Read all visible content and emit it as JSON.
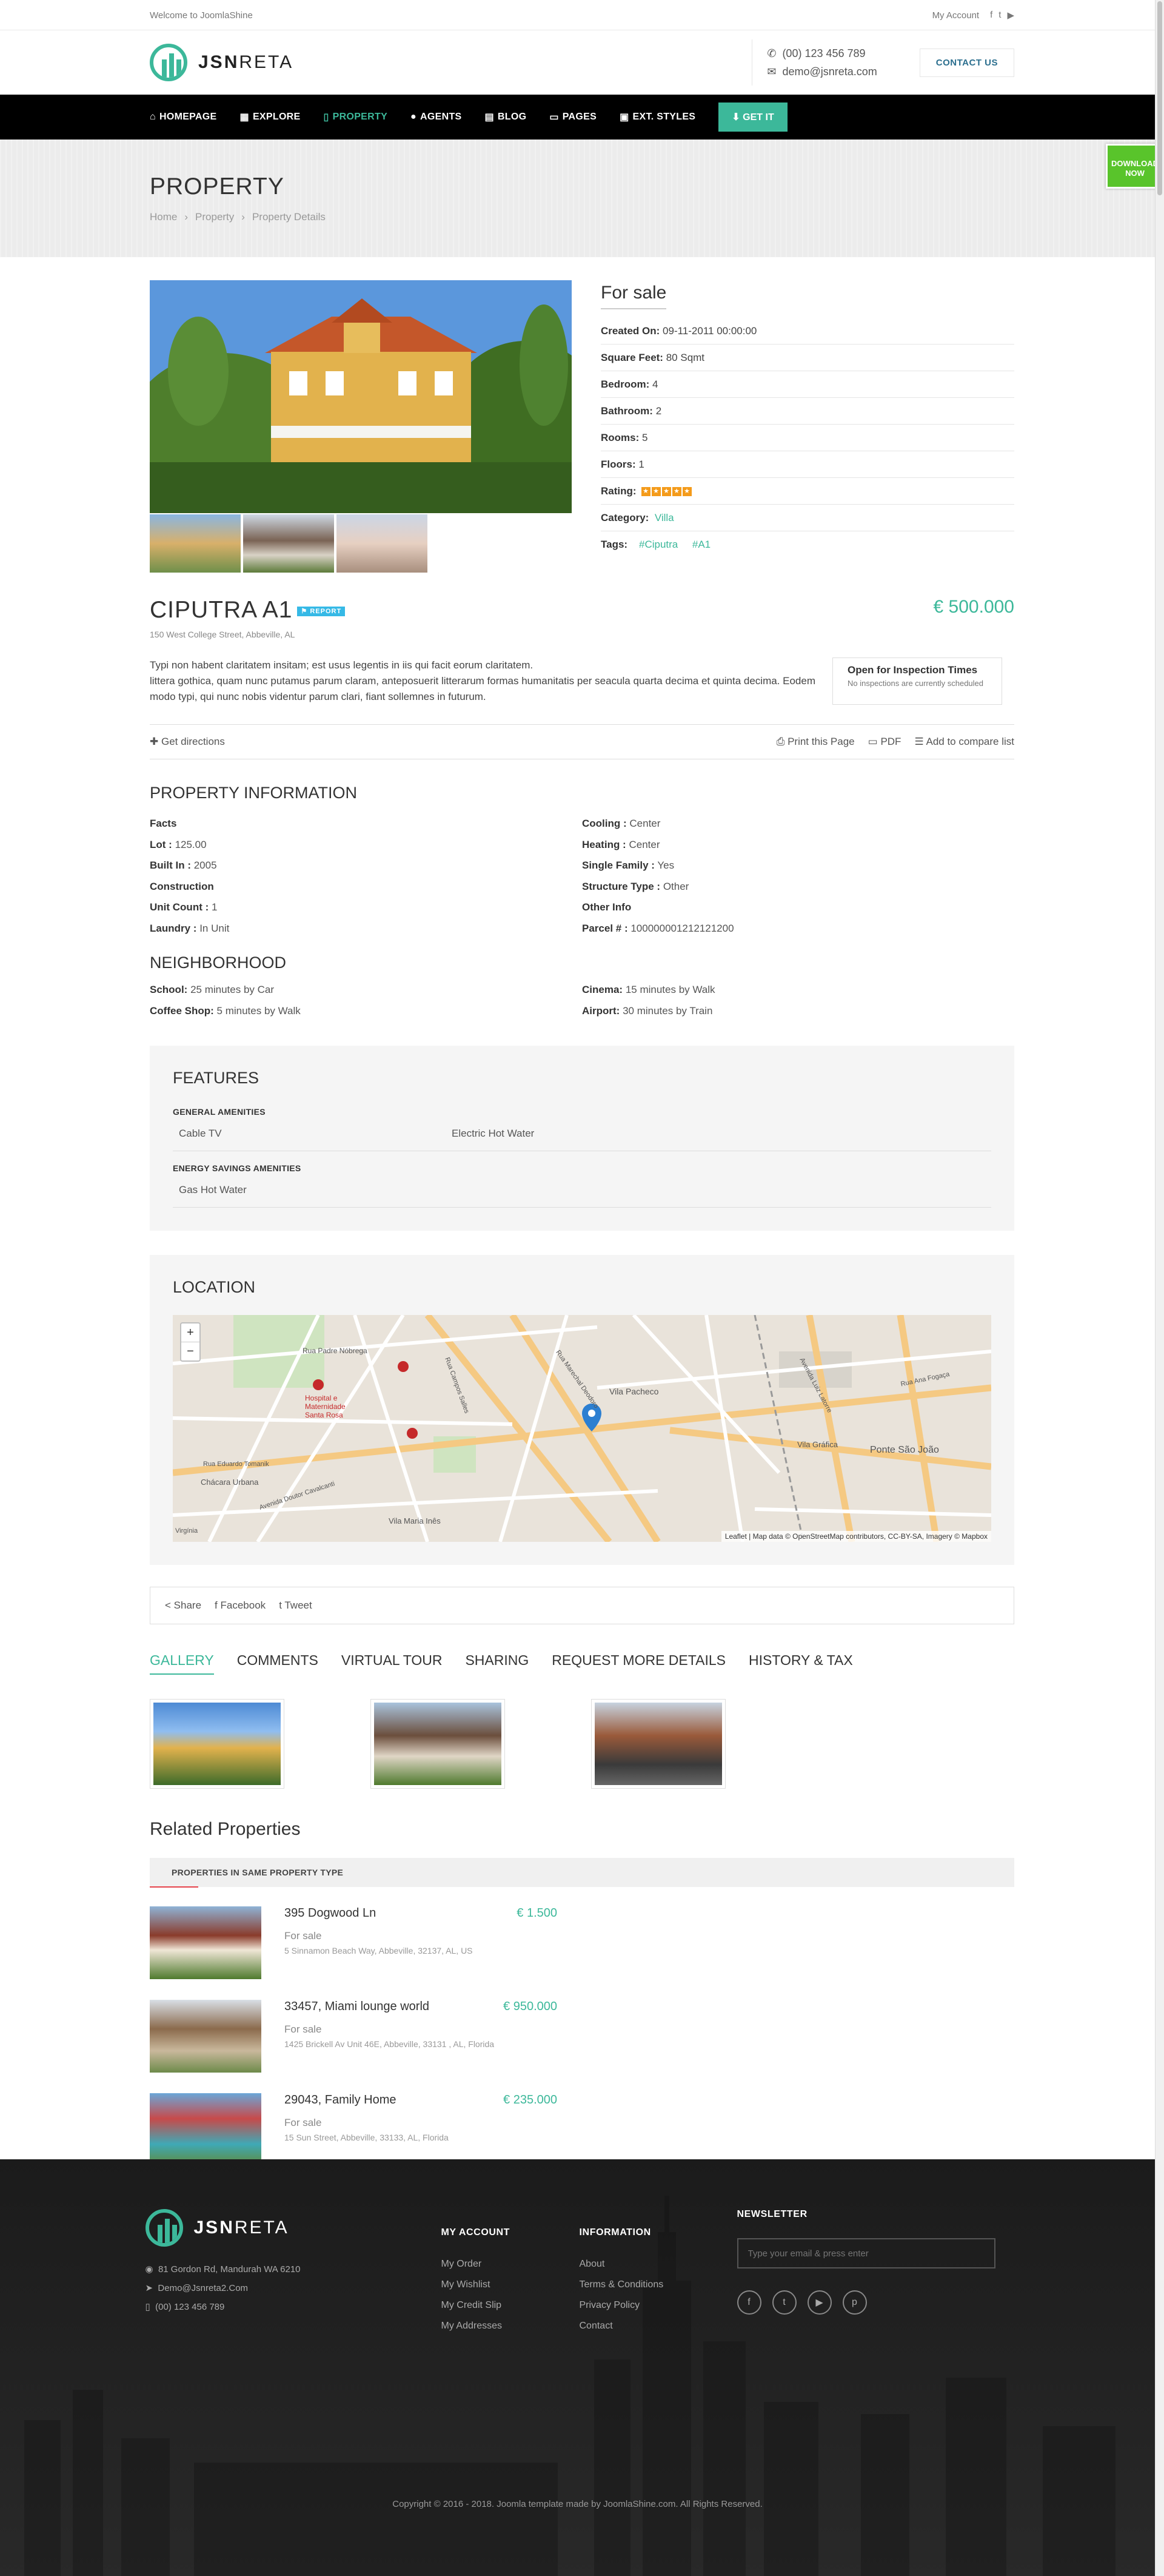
{
  "topbar": {
    "welcome": "Welcome to JoomlaShine",
    "account": "My Account",
    "social": [
      "f",
      "t",
      "yt"
    ]
  },
  "header": {
    "logo_bold": "JSN",
    "logo_light": "RETA",
    "phone": "(00) 123 456 789",
    "email": "demo@jsnreta.com",
    "contact_btn": "CONTACT US"
  },
  "nav": {
    "items": [
      {
        "label": "HOMEPAGE",
        "icon": "home-icon",
        "glyph": "⌂"
      },
      {
        "label": "EXPLORE",
        "icon": "cubes-icon",
        "glyph": "▦"
      },
      {
        "label": "PROPERTY",
        "icon": "building-icon",
        "glyph": "▯"
      },
      {
        "label": "AGENTS",
        "icon": "user-icon",
        "glyph": "●"
      },
      {
        "label": "BLOG",
        "icon": "newspaper-icon",
        "glyph": "▤"
      },
      {
        "label": "PAGES",
        "icon": "file-icon",
        "glyph": "▭"
      },
      {
        "label": "EXT. STYLES",
        "icon": "image-icon",
        "glyph": "▣"
      }
    ],
    "getit": "GET IT"
  },
  "download": {
    "line1": "DOWNLOAD",
    "line2": "NOW"
  },
  "pagehead": {
    "title": "PROPERTY",
    "crumbs": [
      "Home",
      "Property",
      "Property Details"
    ]
  },
  "details": {
    "status": "For sale",
    "rows": [
      {
        "label": "Created On:",
        "value": "09-11-2011 00:00:00"
      },
      {
        "label": "Square Feet:",
        "value": "80 Sqmt"
      },
      {
        "label": "Bedroom:",
        "value": "4"
      },
      {
        "label": "Bathroom:",
        "value": "2"
      },
      {
        "label": "Rooms:",
        "value": "5"
      },
      {
        "label": "Floors:",
        "value": "1"
      }
    ],
    "rating_label": "Rating:",
    "rating": 5,
    "category_label": "Category:",
    "category": "Villa",
    "tags_label": "Tags:",
    "tags": [
      "#Ciputra",
      "#A1"
    ]
  },
  "property": {
    "name": "CIPUTRA A1",
    "report": "REPORT",
    "price": "€ 500.000",
    "address": "150 West College Street, Abbeville, AL",
    "desc1": "Typi non habent claritatem insitam; est usus legentis in iis qui facit eorum claritatem.",
    "desc2": "littera gothica, quam nunc putamus parum claram, anteposuerit litterarum formas humanitatis per seacula quarta decima et quinta decima. Eodem modo typi, qui nunc nobis videntur parum clari, fiant sollemnes in futurum.",
    "inspect_title": "Open for Inspection Times",
    "inspect_text": "No inspections are currently scheduled"
  },
  "actions": {
    "directions": "Get directions",
    "print": "Print this Page",
    "pdf": "PDF",
    "compare": "Add to compare list"
  },
  "info": {
    "title": "PROPERTY INFORMATION",
    "left": [
      {
        "label": "Facts",
        "value": ""
      },
      {
        "label": "Lot :",
        "value": "125.00"
      },
      {
        "label": "Built In :",
        "value": "2005"
      },
      {
        "label": "Construction",
        "value": ""
      },
      {
        "label": "Unit Count :",
        "value": "1"
      },
      {
        "label": "Laundry :",
        "value": "In Unit"
      }
    ],
    "right": [
      {
        "label": "Cooling :",
        "value": "Center"
      },
      {
        "label": "Heating :",
        "value": "Center"
      },
      {
        "label": "Single Family :",
        "value": "Yes"
      },
      {
        "label": "Structure Type :",
        "value": "Other"
      },
      {
        "label": "Other Info",
        "value": ""
      },
      {
        "label": "Parcel # :",
        "value": "100000001212121200"
      }
    ]
  },
  "neighborhood": {
    "title": "NEIGHBORHOOD",
    "left": [
      {
        "label": "School:",
        "value": "25 minutes by Car"
      },
      {
        "label": "Coffee Shop:",
        "value": "5 minutes by Walk"
      }
    ],
    "right": [
      {
        "label": "Cinema:",
        "value": "15 minutes by Walk"
      },
      {
        "label": "Airport:",
        "value": "30 minutes by Train"
      }
    ]
  },
  "features": {
    "title": "FEATURES",
    "general_title": "GENERAL AMENITIES",
    "general": [
      "Cable TV",
      "Electric Hot Water"
    ],
    "energy_title": "ENERGY SAVINGS AMENITIES",
    "energy": [
      "Gas Hot Water"
    ]
  },
  "location": {
    "title": "LOCATION",
    "zoom_in": "+",
    "zoom_out": "−",
    "attribution": "Leaflet | Map data © OpenStreetMap contributors, CC-BY-SA, Imagery © Mapbox",
    "labels": [
      "Rua Padre Nóbrega",
      "Hospital e Maternidade Santa Rosa",
      "Vila Pacheco",
      "Vila Gráfica",
      "Ponte São João",
      "Chácara Urbana",
      "Vila Maria Inês",
      "Rua Eduardo Tomanik",
      "Avenida Doutor Cavalcanti",
      "Rua Marechal Deodoro",
      "Avenida Luiz Latorre",
      "Rua Campos Salles",
      "Virgínia",
      "Rua Ana Fogaça"
    ]
  },
  "share": {
    "share": "Share",
    "facebook": "Facebook",
    "tweet": "Tweet"
  },
  "tabs": [
    "GALLERY",
    "COMMENTS",
    "VIRTUAL TOUR",
    "SHARING",
    "REQUEST MORE DETAILS",
    "HISTORY & TAX"
  ],
  "related": {
    "title": "Related Properties",
    "bar": "PROPERTIES IN SAME PROPERTY TYPE",
    "items": [
      {
        "name": "395 Dogwood Ln",
        "price": "€ 1.500",
        "status": "For sale",
        "address": "5 Sinnamon Beach Way, Abbeville, 32137, AL, US"
      },
      {
        "name": "33457, Miami lounge world",
        "price": "€ 950.000",
        "status": "For sale",
        "address": "1425 Brickell Av Unit 46E, Abbeville, 33131 , AL, Florida"
      },
      {
        "name": "29043, Family Home",
        "price": "€ 235.000",
        "status": "For sale",
        "address": "15 Sun Street, Abbeville, 33133, AL, Florida"
      }
    ]
  },
  "footer": {
    "logo_bold": "JSN",
    "logo_light": "RETA",
    "address": "81 Gordon Rd, Mandurah WA 6210",
    "email": "Demo@Jsnreta2.Com",
    "phone": "(00) 123 456 789",
    "account_title": "MY ACCOUNT",
    "account_links": [
      "My Order",
      "My Wishlist",
      "My Credit Slip",
      "My Addresses"
    ],
    "info_title": "INFORMATION",
    "info_links": [
      "About",
      "Terms & Conditions",
      "Privacy Policy",
      "Contact"
    ],
    "news_title": "NEWSLETTER",
    "news_placeholder": "Type your email & press enter",
    "social": [
      "f",
      "t",
      "▶",
      "p"
    ],
    "copyright": "Copyright © 2016 - 2018. Joomla template made by JoomlaShine.com. All Rights Reserved."
  },
  "colors": {
    "accent": "#3cb89a",
    "rating": "#f49b1a",
    "report": "#36b9e6",
    "download": "#59c42b",
    "nav": "#000000"
  }
}
